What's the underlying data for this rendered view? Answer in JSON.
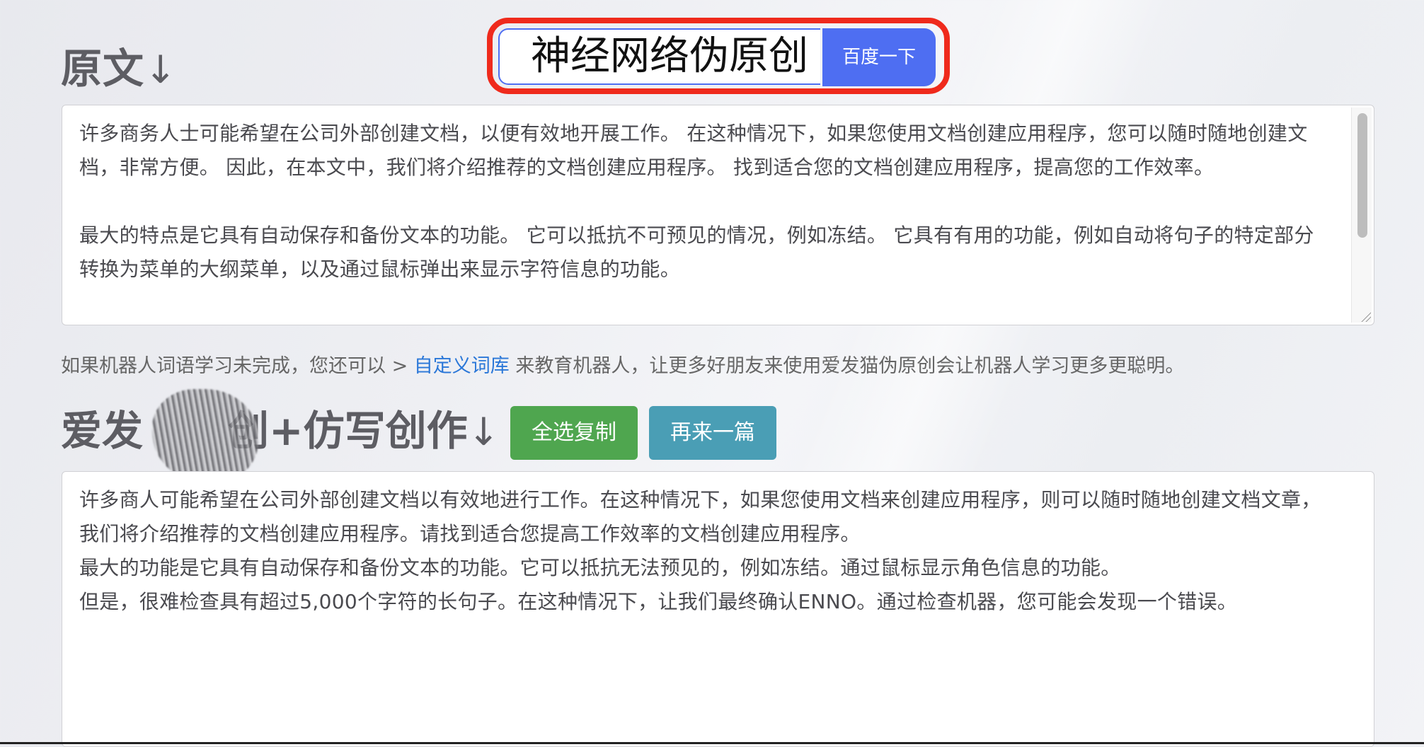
{
  "search": {
    "query": "神经网络伪原创",
    "button_label": "百度一下",
    "highlight_color": "#ef2a1c",
    "button_color": "#4e6ef2"
  },
  "original": {
    "heading": "原文",
    "heading_arrow": "↓",
    "paragraphs": [
      "许多商务人士可能希望在公司外部创建文档，以便有效地开展工作。 在这种情况下，如果您使用文档创建应用程序，您可以随时随地创建文档，非常方便。 因此，在本文中，我们将介绍推荐的文档创建应用程序。 找到适合您的文档创建应用程序，提高您的工作效率。",
      "最大的特点是它具有自动保存和备份文本的功能。 它可以抵抗不可预见的情况，例如冻结。 它具有有用的功能，例如自动将句子的特定部分转换为菜单的大纲菜单，以及通过鼠标弹出来显示字符信息的功能。"
    ]
  },
  "notice": {
    "prefix": "如果机器人词语学习未完成，您还可以 > ",
    "link_label": "自定义词库",
    "suffix": " 来教育机器人，让更多好朋友来使用爱发猫伪原创会让机器人学习更多更聪明。",
    "link_color": "#2a77d8"
  },
  "result": {
    "heading_visible_start": "爱发",
    "heading_visible_end": "创+仿写创作",
    "heading_arrow": "↓",
    "copy_button_label": "全选复制",
    "again_button_label": "再来一篇",
    "copy_button_color": "#4fa64f",
    "again_button_color": "#4a9eb5",
    "lines": [
      "许多商人可能希望在公司外部创建文档以有效地进行工作。在这种情况下，如果您使用文档来创建应用程序，则可以随时随地创建文档文章，我们将介绍推荐的文档创建应用程序。请找到适合您提高工作效率的文档创建应用程序。",
      "最大的功能是它具有自动保存和备份文本的功能。它可以抵抗无法预见的，例如冻结。通过鼠标显示角色信息的功能。",
      "但是，很难检查具有超过5,000个字符的长句子。在这种情况下，让我们最终确认ENNO。通过检查机器，您可能会发现一个错误。"
    ]
  }
}
